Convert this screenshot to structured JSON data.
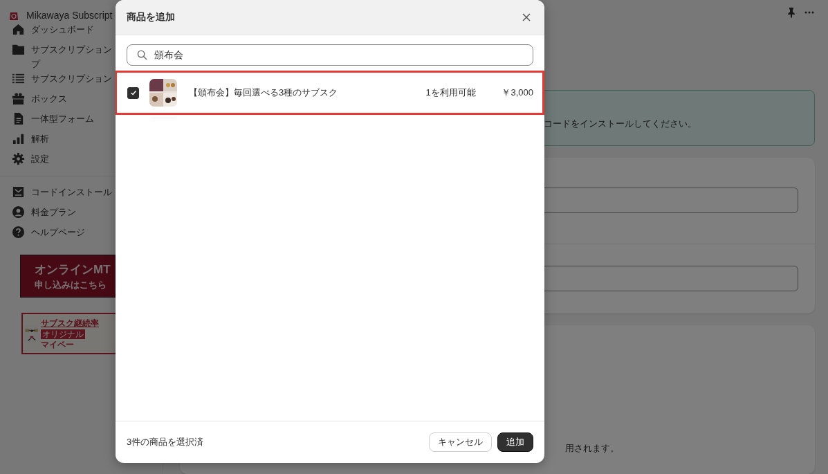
{
  "app": {
    "name": "Mikawaya Subscript"
  },
  "sidebar": {
    "nav": [
      {
        "label": "ダッシュボード"
      },
      {
        "label": "サブスクリプション",
        "continued": "プ"
      },
      {
        "label": "サブスクリプション"
      },
      {
        "label": "ボックス"
      },
      {
        "label": "一体型フォーム"
      },
      {
        "label": "解析"
      },
      {
        "label": "設定"
      }
    ],
    "secondary": [
      {
        "label": "コードインストール"
      },
      {
        "label": "料金プラン"
      },
      {
        "label": "ヘルプページ"
      }
    ],
    "banners": [
      {
        "kind": "promo",
        "lines": [
          "オンラインMT",
          "申し込みはこちら"
        ]
      },
      {
        "kind": "ad",
        "title": "サブスク継続率",
        "badge": "オリジナル",
        "text": "マイペー"
      }
    ]
  },
  "main": {
    "notice": "コードをインストールしてください。",
    "note": "用されます。"
  },
  "modal": {
    "title": "商品を追加",
    "search": {
      "value": "頒布会"
    },
    "products": [
      {
        "name": "【頒布会】毎回選べる3種のサブスク",
        "availability": "1を利用可能",
        "price": "￥3,000",
        "selected": true
      }
    ],
    "footer": {
      "summary": "3件の商品を選択済",
      "buttons": [
        {
          "label": "キャンセル",
          "kind": "secondary"
        },
        {
          "label": "追加",
          "kind": "primary"
        }
      ]
    }
  }
}
